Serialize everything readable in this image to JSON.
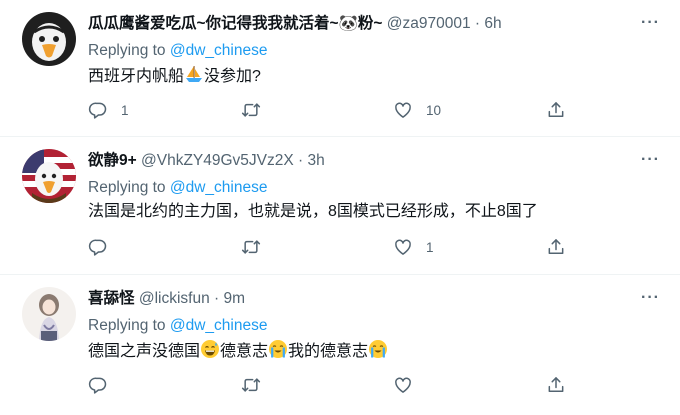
{
  "tweets": [
    {
      "name": "瓜瓜鹰酱爱吃瓜~你记得我我就活着~🐼粉~",
      "handle": "@za970001",
      "time": "6h",
      "replying_prefix": "Replying to",
      "replying_to": "@dw_chinese",
      "text_before": "西班牙内帆船",
      "emoji": "sailboat",
      "text_after": "没参加?",
      "reply_count": "1",
      "retweet_count": "",
      "like_count": "10"
    },
    {
      "name": "欲静9+",
      "handle": "@VhkZY49Gv5JVz2X",
      "time": "3h",
      "replying_prefix": "Replying to",
      "replying_to": "@dw_chinese",
      "text": "法国是北约的主力国，也就是说，8国模式已经形成，不止8国了",
      "reply_count": "",
      "retweet_count": "",
      "like_count": "1"
    },
    {
      "name": "喜舔怪",
      "handle": "@lickisfun",
      "time": "9m",
      "replying_prefix": "Replying to",
      "replying_to": "@dw_chinese",
      "text_part1": "德国之声没德国",
      "text_part2": "德意志",
      "text_part3": "我的德意志",
      "emojis": [
        "grinning-sweat-face",
        "loudly-crying-face",
        "loudly-crying-face"
      ],
      "reply_count": "",
      "retweet_count": "",
      "like_count": ""
    }
  ],
  "separator": " · ",
  "more_label": "···",
  "icons": [
    "more-icon",
    "reply-icon",
    "retweet-icon",
    "like-icon",
    "share-icon"
  ],
  "colors": {
    "link": "#1d9bf0",
    "secondary": "#536471",
    "text": "#0f1419",
    "border": "#eff3f4"
  }
}
